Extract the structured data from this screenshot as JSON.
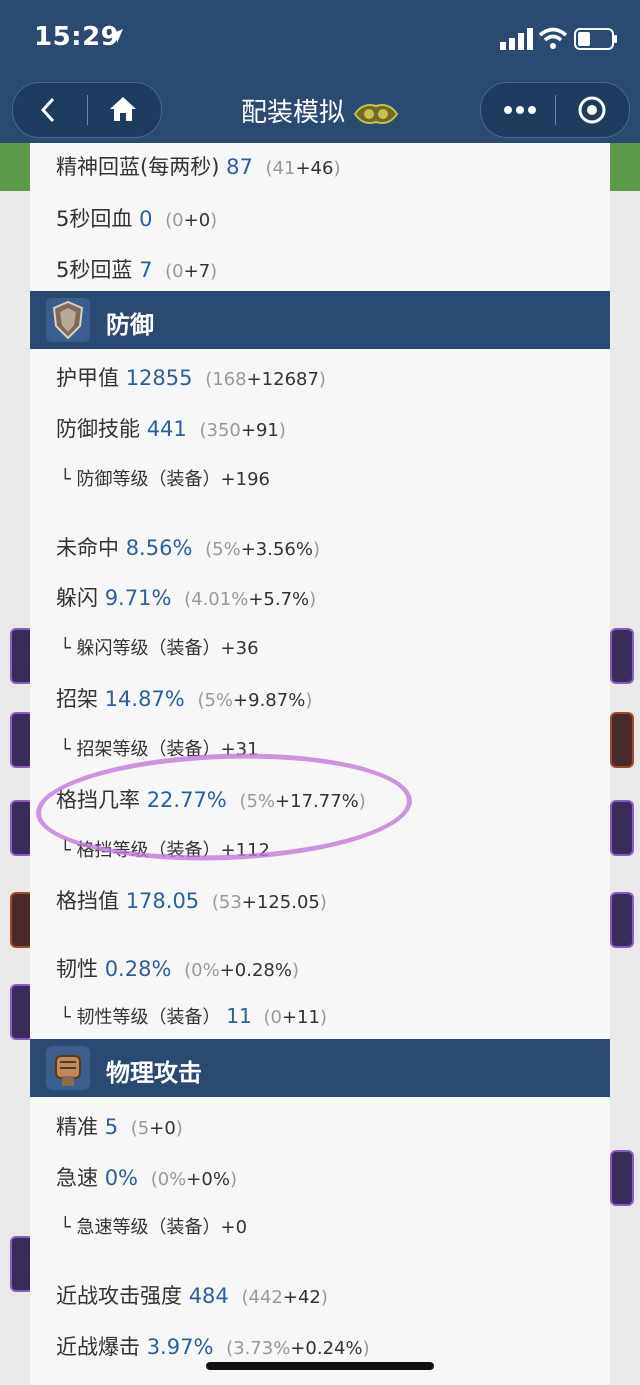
{
  "status_bar": {
    "time": "15:29"
  },
  "nav": {
    "title": "配装模拟"
  },
  "top_rows": [
    {
      "label": "精神回蓝(每两秒)",
      "value": "87",
      "base": "41",
      "bonus": "+46"
    },
    {
      "label": "5秒回血",
      "value": "0",
      "base": "0",
      "bonus": "+0"
    },
    {
      "label": "5秒回蓝",
      "value": "7",
      "base": "0",
      "bonus": "+7"
    }
  ],
  "defense": {
    "title": "防御",
    "armor": {
      "label": "护甲值",
      "value": "12855",
      "base": "168",
      "bonus": "+12687"
    },
    "defense_skill": {
      "label": "防御技能",
      "value": "441",
      "base": "350",
      "bonus": "+91"
    },
    "defense_rating": {
      "label": "└ 防御等级（装备）+196"
    },
    "miss": {
      "label": "未命中",
      "value": "8.56%",
      "base": "5%",
      "bonus": "+3.56%"
    },
    "dodge": {
      "label": "躲闪",
      "value": "9.71%",
      "base": "4.01%",
      "bonus": "+5.7%"
    },
    "dodge_rating": {
      "label": "└ 躲闪等级（装备）+36"
    },
    "parry": {
      "label": "招架",
      "value": "14.87%",
      "base": "5%",
      "bonus": "+9.87%"
    },
    "parry_rating": {
      "label": "└ 招架等级（装备）+31"
    },
    "block_chance": {
      "label": "格挡几率",
      "value": "22.77%",
      "base": "5%",
      "bonus": "+17.77%"
    },
    "block_rating": {
      "label": "└ 格挡等级（装备）+112"
    },
    "block_value": {
      "label": "格挡值",
      "value": "178.05",
      "base": "53",
      "bonus": "+125.05"
    },
    "resilience": {
      "label": "韧性",
      "value": "0.28%",
      "base": "0%",
      "bonus": "+0.28%"
    },
    "resilience_rating": {
      "label": "└ 韧性等级（装备）",
      "value": "11",
      "base": "0",
      "bonus": "+11"
    }
  },
  "physical": {
    "title": "物理攻击",
    "hit": {
      "label": "精准",
      "value": "5",
      "base": "5",
      "bonus": "+0"
    },
    "haste": {
      "label": "急速",
      "value": "0%",
      "base": "0%",
      "bonus": "+0%"
    },
    "haste_rating": {
      "label": "└ 急速等级（装备）+0"
    },
    "melee_ap": {
      "label": "近战攻击强度",
      "value": "484",
      "base": "442",
      "bonus": "+42"
    },
    "melee_crit": {
      "label": "近战爆击",
      "value": "3.97%",
      "base": "3.73%",
      "bonus": "+0.24%"
    }
  },
  "colors": {
    "header": "#2b4a73",
    "value_blue": "#2c5f9e",
    "highlight_ring": "#c07ad9"
  }
}
